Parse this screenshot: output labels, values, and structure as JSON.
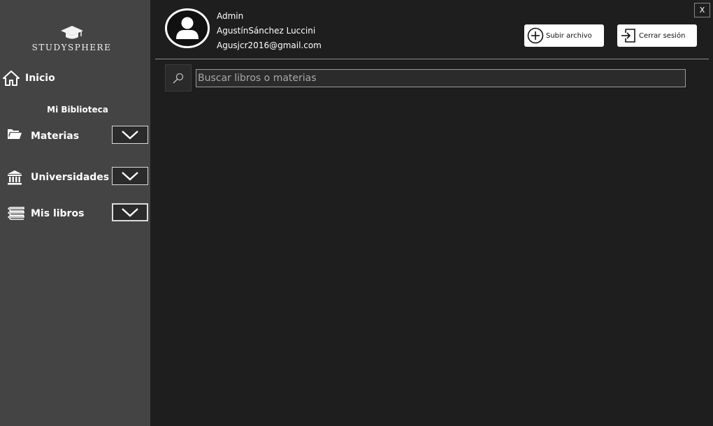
{
  "brand": {
    "name": "STUDYSPHERE",
    "logo_icon": "graduation-cap-icon"
  },
  "nav": {
    "home": {
      "label": "Inicio",
      "icon": "home-icon"
    },
    "section_title": "Mi Biblioteca",
    "items": [
      {
        "label": "Materias",
        "icon": "folder-icon"
      },
      {
        "label": "Universidades",
        "icon": "university-icon"
      },
      {
        "label": "Mis libros",
        "icon": "books-icon"
      }
    ]
  },
  "user": {
    "role": "Admin",
    "name": "AgustínSánchez Luccini",
    "email": "Agusjcr2016@gmail.com"
  },
  "header": {
    "upload_label": "Subir archivo",
    "logout_label": "Cerrar sesión",
    "close_label": "X"
  },
  "search": {
    "placeholder": "Buscar libros o materias",
    "value": ""
  },
  "colors": {
    "sidebar": "#444444",
    "main": "#1e1e1e",
    "button": "#ffffff"
  }
}
